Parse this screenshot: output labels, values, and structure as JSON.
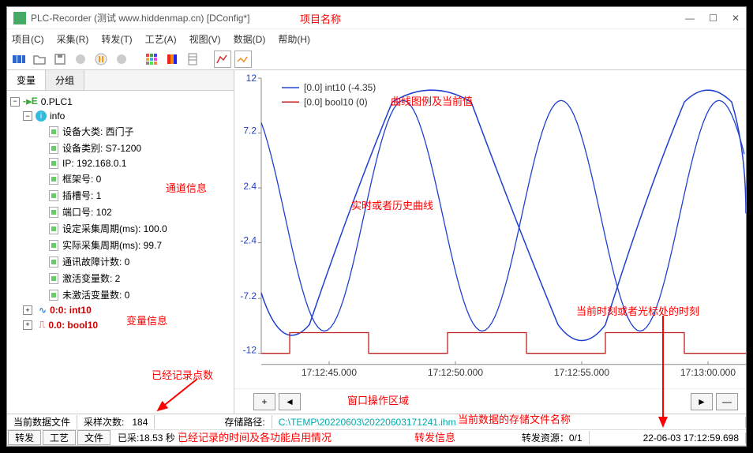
{
  "window": {
    "title": "PLC-Recorder (测试 www.hiddenmap.cn) [DConfig*]",
    "min": "—",
    "max": "☐",
    "close": "✕"
  },
  "menu": {
    "project": "项目(C)",
    "collect": "采集(R)",
    "forward": "转发(T)",
    "process": "工艺(A)",
    "view": "视图(V)",
    "data": "数据(D)",
    "help": "帮助(H)"
  },
  "tabs": {
    "var": "变量",
    "group": "分组"
  },
  "tree": {
    "root": "0.PLC1",
    "info": "info",
    "items": [
      "设备大类: 西门子",
      "设备类别: S7-1200",
      "IP: 192.168.0.1",
      "框架号: 0",
      "插槽号: 1",
      "端口号: 102",
      "设定采集周期(ms): 100.0",
      "实际采集周期(ms): 99.7",
      "通讯故障计数: 0",
      "激活变量数: 2",
      "未激活变量数: 0"
    ],
    "var1": "0:0: int10",
    "var2": "0.0: bool10"
  },
  "legend": {
    "s1": "[0.0] int10 (-4.35)",
    "s2": "[0.0] bool10 (0)"
  },
  "yticks": [
    "12",
    "7.2",
    "2.4",
    "-2.4",
    "-7.2",
    "-12"
  ],
  "xticks": [
    "17:12:45.000",
    "17:12:50.000",
    "17:12:55.000",
    "17:13:00.000"
  ],
  "controls": {
    "plus": "+",
    "left": "◄",
    "right": "►",
    "minus": "—"
  },
  "status": {
    "file_label": "当前数据文件",
    "samples_label": "采样次数:",
    "samples": "184",
    "path_label": "存储路径:",
    "path": "C:\\TEMP\\20220603\\20220603171241.ihm",
    "forward": "转发",
    "process": "工艺",
    "file": "文件",
    "recorded": "已采:18.53 秒",
    "resource": "转发资源：0/1",
    "timestamp": "22-06-03 17:12:59.698"
  },
  "annotations": {
    "project_name": "项目名称",
    "channel_info": "通道信息",
    "var_info": "变量信息",
    "points": "已经记录点数",
    "rec_time": "已经记录的时间及各功能启用情况",
    "legend_curr": "曲线图例及当前值",
    "realtime": "实时或者历史曲线",
    "win_op": "窗口操作区域",
    "file_name": "当前数据的存储文件名称",
    "forward_info": "转发信息",
    "timestamp": "当前时刻或者光标处的时刻"
  },
  "chart_data": {
    "type": "line",
    "title": "",
    "xlabel": "",
    "ylabel": "",
    "ylim": [
      -12,
      12
    ],
    "x": [
      "17:12:45.000",
      "17:12:50.000",
      "17:12:55.000",
      "17:13:00.000"
    ],
    "series": [
      {
        "name": "[0.0] int10",
        "color": "#2040d0",
        "type": "sine",
        "amplitude": 10,
        "period_s": 6.2,
        "current": -4.35
      },
      {
        "name": "[0.0] bool10",
        "color": "#c02020",
        "type": "square",
        "low": -12,
        "high": -10,
        "period_s": 6.2,
        "current": 0
      }
    ]
  }
}
